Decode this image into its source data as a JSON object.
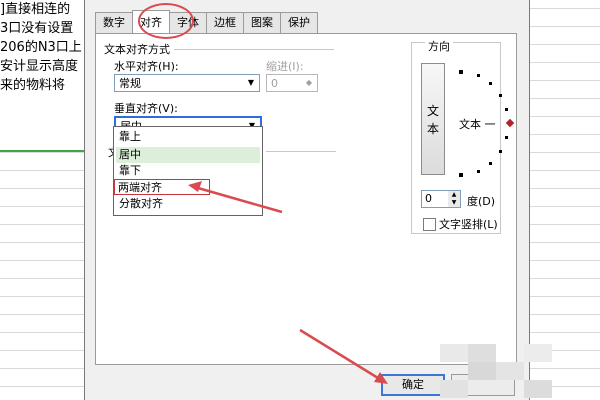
{
  "background_text": [
    "]直接相连的",
    "3口没有设置",
    "206的N3口上",
    "安计显示高度",
    "来的物料将"
  ],
  "tabs": [
    {
      "label": "数字",
      "active": false
    },
    {
      "label": "对齐",
      "active": true
    },
    {
      "label": "字体",
      "active": false
    },
    {
      "label": "边框",
      "active": false
    },
    {
      "label": "图案",
      "active": false
    },
    {
      "label": "保护",
      "active": false
    }
  ],
  "alignment": {
    "section_title": "文本对齐方式",
    "horizontal_label": "水平对齐(H):",
    "horizontal_value": "常规",
    "indent_label": "缩进(I):",
    "indent_value": "0",
    "vertical_label": "垂直对齐(V):",
    "vertical_value": "居中",
    "hidden_section_char": "文",
    "vertical_options": [
      {
        "label": "靠上",
        "selected": false,
        "highlighted": false
      },
      {
        "label": "居中",
        "selected": true,
        "highlighted": false
      },
      {
        "label": "靠下",
        "selected": false,
        "highlighted": false
      },
      {
        "label": "两端对齐",
        "selected": false,
        "highlighted": true
      },
      {
        "label": "分散对齐",
        "selected": false,
        "highlighted": false
      }
    ]
  },
  "orientation": {
    "title": "方向",
    "vertical_text_chars": [
      "文",
      "本"
    ],
    "dial_label": "文本 一",
    "degree_value": "0",
    "degree_label": "度(D)",
    "vertical_arrange_label": "文字竖排(L)"
  },
  "buttons": {
    "ok_label": "确定"
  },
  "colors": {
    "accent": "#3a77d6",
    "annotation": "#d94b4f",
    "selected_option": "#dcefd9",
    "gridline_green": "#3aa845"
  }
}
